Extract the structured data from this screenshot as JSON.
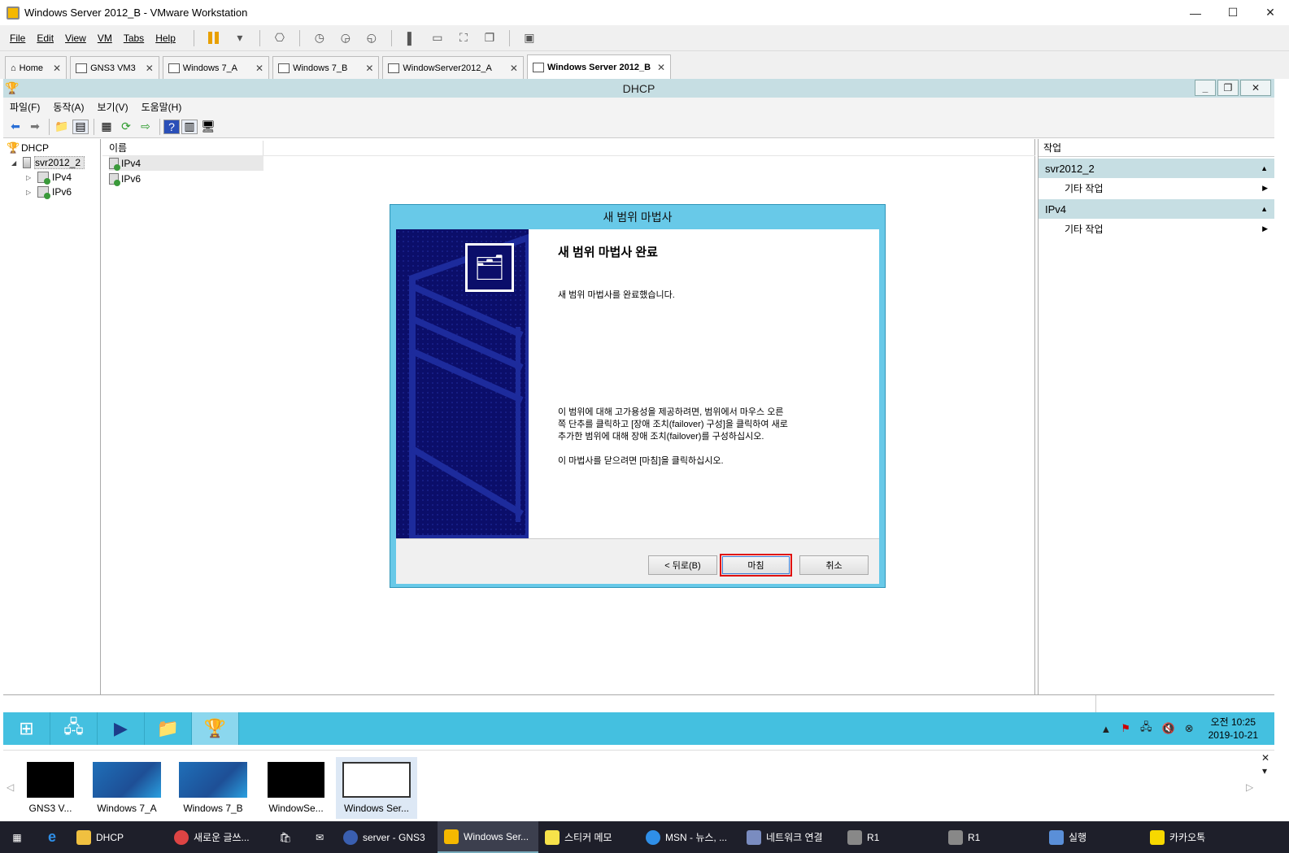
{
  "vmware": {
    "window_title": "Windows Server 2012_B - VMware Workstation",
    "menu": [
      "File",
      "Edit",
      "View",
      "VM",
      "Tabs",
      "Help"
    ],
    "tabs": [
      {
        "label": "Home"
      },
      {
        "label": "GNS3 VM3"
      },
      {
        "label": "Windows 7_A"
      },
      {
        "label": "Windows 7_B"
      },
      {
        "label": "WindowServer2012_A"
      },
      {
        "label": "Windows Server 2012_B"
      }
    ]
  },
  "mmc": {
    "title": "DHCP",
    "menu": [
      "파일(F)",
      "동작(A)",
      "보기(V)",
      "도움말(H)"
    ],
    "tree": {
      "root": "DHCP",
      "server": "svr2012_2",
      "children": [
        "IPv4",
        "IPv6"
      ]
    },
    "list": {
      "header": "이름",
      "rows": [
        "IPv4",
        "IPv6"
      ]
    },
    "actions": {
      "title": "작업",
      "groups": [
        {
          "name": "svr2012_2",
          "item": "기타 작업"
        },
        {
          "name": "IPv4",
          "item": "기타 작업"
        }
      ]
    }
  },
  "dialog": {
    "title": "새 범위 마법사",
    "heading": "새 범위 마법사 완료",
    "intro": "새 범위 마법사를 완료했습니다.",
    "para1_line1": "이 범위에 대해 고가용성을 제공하려면, 범위에서 마우스 오른",
    "para1_line2": "쪽 단추를 클릭하고 [장애 조치(failover) 구성]을 클릭하여 새로",
    "para1_line3": "추가한 범위에 대해 장애 조치(failover)를 구성하십시오.",
    "para2": "이 마법사를 닫으려면 [마침]을 클릭하십시오.",
    "back_label": "< 뒤로(B)",
    "finish_label": "마침",
    "cancel_label": "취소"
  },
  "guest_taskbar": {
    "clock_time": "오전 10:25",
    "clock_date": "2019-10-21"
  },
  "thumbnails": [
    "GNS3 V...",
    "Windows 7_A",
    "Windows 7_B",
    "WindowSe...",
    "Windows Ser..."
  ],
  "host_taskbar": {
    "items": [
      "DHCP",
      "새로운 글쓰...",
      "server - GNS3",
      "Windows Ser...",
      "스티커 메모",
      "MSN - 뉴스, ...",
      "네트워크 연결",
      "R1",
      "R1",
      "실행",
      "카카오톡"
    ]
  }
}
